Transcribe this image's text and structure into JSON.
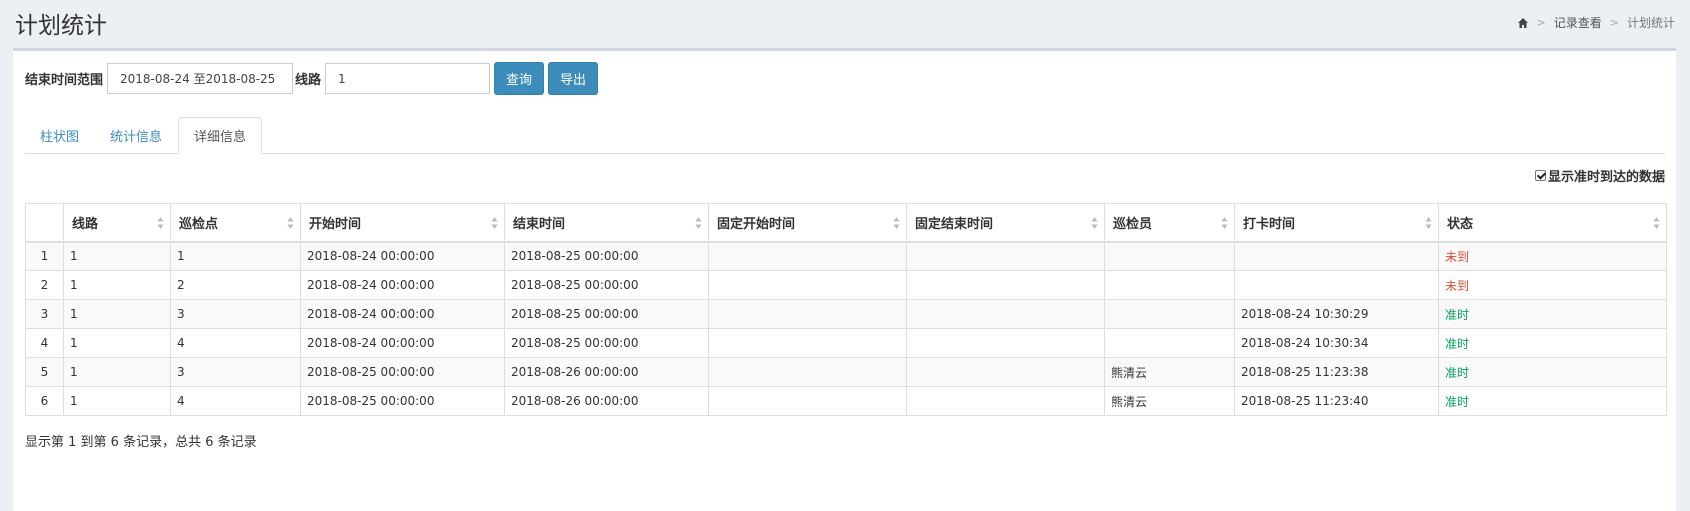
{
  "header": {
    "title": "计划统计",
    "breadcrumb": [
      "记录查看",
      "计划统计"
    ]
  },
  "filter": {
    "date_label": "结束时间范围",
    "date_value": "2018-08-24 至2018-08-25",
    "route_label": "线路",
    "route_value": "1",
    "query_label": "查询",
    "export_label": "导出"
  },
  "tabs": [
    "柱状图",
    "统计信息",
    "详细信息"
  ],
  "active_tab": 2,
  "checkbox_label": "显示准时到达的数据",
  "columns": [
    "线路",
    "巡检点",
    "开始时间",
    "结束时间",
    "固定开始时间",
    "固定结束时间",
    "巡检员",
    "打卡时间",
    "状态"
  ],
  "rows": [
    {
      "idx": "1",
      "route": "1",
      "point": "1",
      "start": "2018-08-24 00:00:00",
      "end": "2018-08-25 00:00:00",
      "fixed_start": "",
      "fixed_end": "",
      "inspector": "",
      "punch": "",
      "status": "未到",
      "status_type": "late"
    },
    {
      "idx": "2",
      "route": "1",
      "point": "2",
      "start": "2018-08-24 00:00:00",
      "end": "2018-08-25 00:00:00",
      "fixed_start": "",
      "fixed_end": "",
      "inspector": "",
      "punch": "",
      "status": "未到",
      "status_type": "late"
    },
    {
      "idx": "3",
      "route": "1",
      "point": "3",
      "start": "2018-08-24 00:00:00",
      "end": "2018-08-25 00:00:00",
      "fixed_start": "",
      "fixed_end": "",
      "inspector": "",
      "punch": "2018-08-24 10:30:29",
      "status": "准时",
      "status_type": "ok"
    },
    {
      "idx": "4",
      "route": "1",
      "point": "4",
      "start": "2018-08-24 00:00:00",
      "end": "2018-08-25 00:00:00",
      "fixed_start": "",
      "fixed_end": "",
      "inspector": "",
      "punch": "2018-08-24 10:30:34",
      "status": "准时",
      "status_type": "ok"
    },
    {
      "idx": "5",
      "route": "1",
      "point": "3",
      "start": "2018-08-25 00:00:00",
      "end": "2018-08-26 00:00:00",
      "fixed_start": "",
      "fixed_end": "",
      "inspector": "熊清云",
      "punch": "2018-08-25 11:23:38",
      "status": "准时",
      "status_type": "ok"
    },
    {
      "idx": "6",
      "route": "1",
      "point": "4",
      "start": "2018-08-25 00:00:00",
      "end": "2018-08-26 00:00:00",
      "fixed_start": "",
      "fixed_end": "",
      "inspector": "熊清云",
      "punch": "2018-08-25 11:23:40",
      "status": "准时",
      "status_type": "ok"
    }
  ],
  "footer": "显示第 1 到第 6 条记录，总共 6 条记录",
  "colors": {
    "primary": "#3c8dbc",
    "late": "#dd4b39",
    "ok": "#00a65a"
  }
}
